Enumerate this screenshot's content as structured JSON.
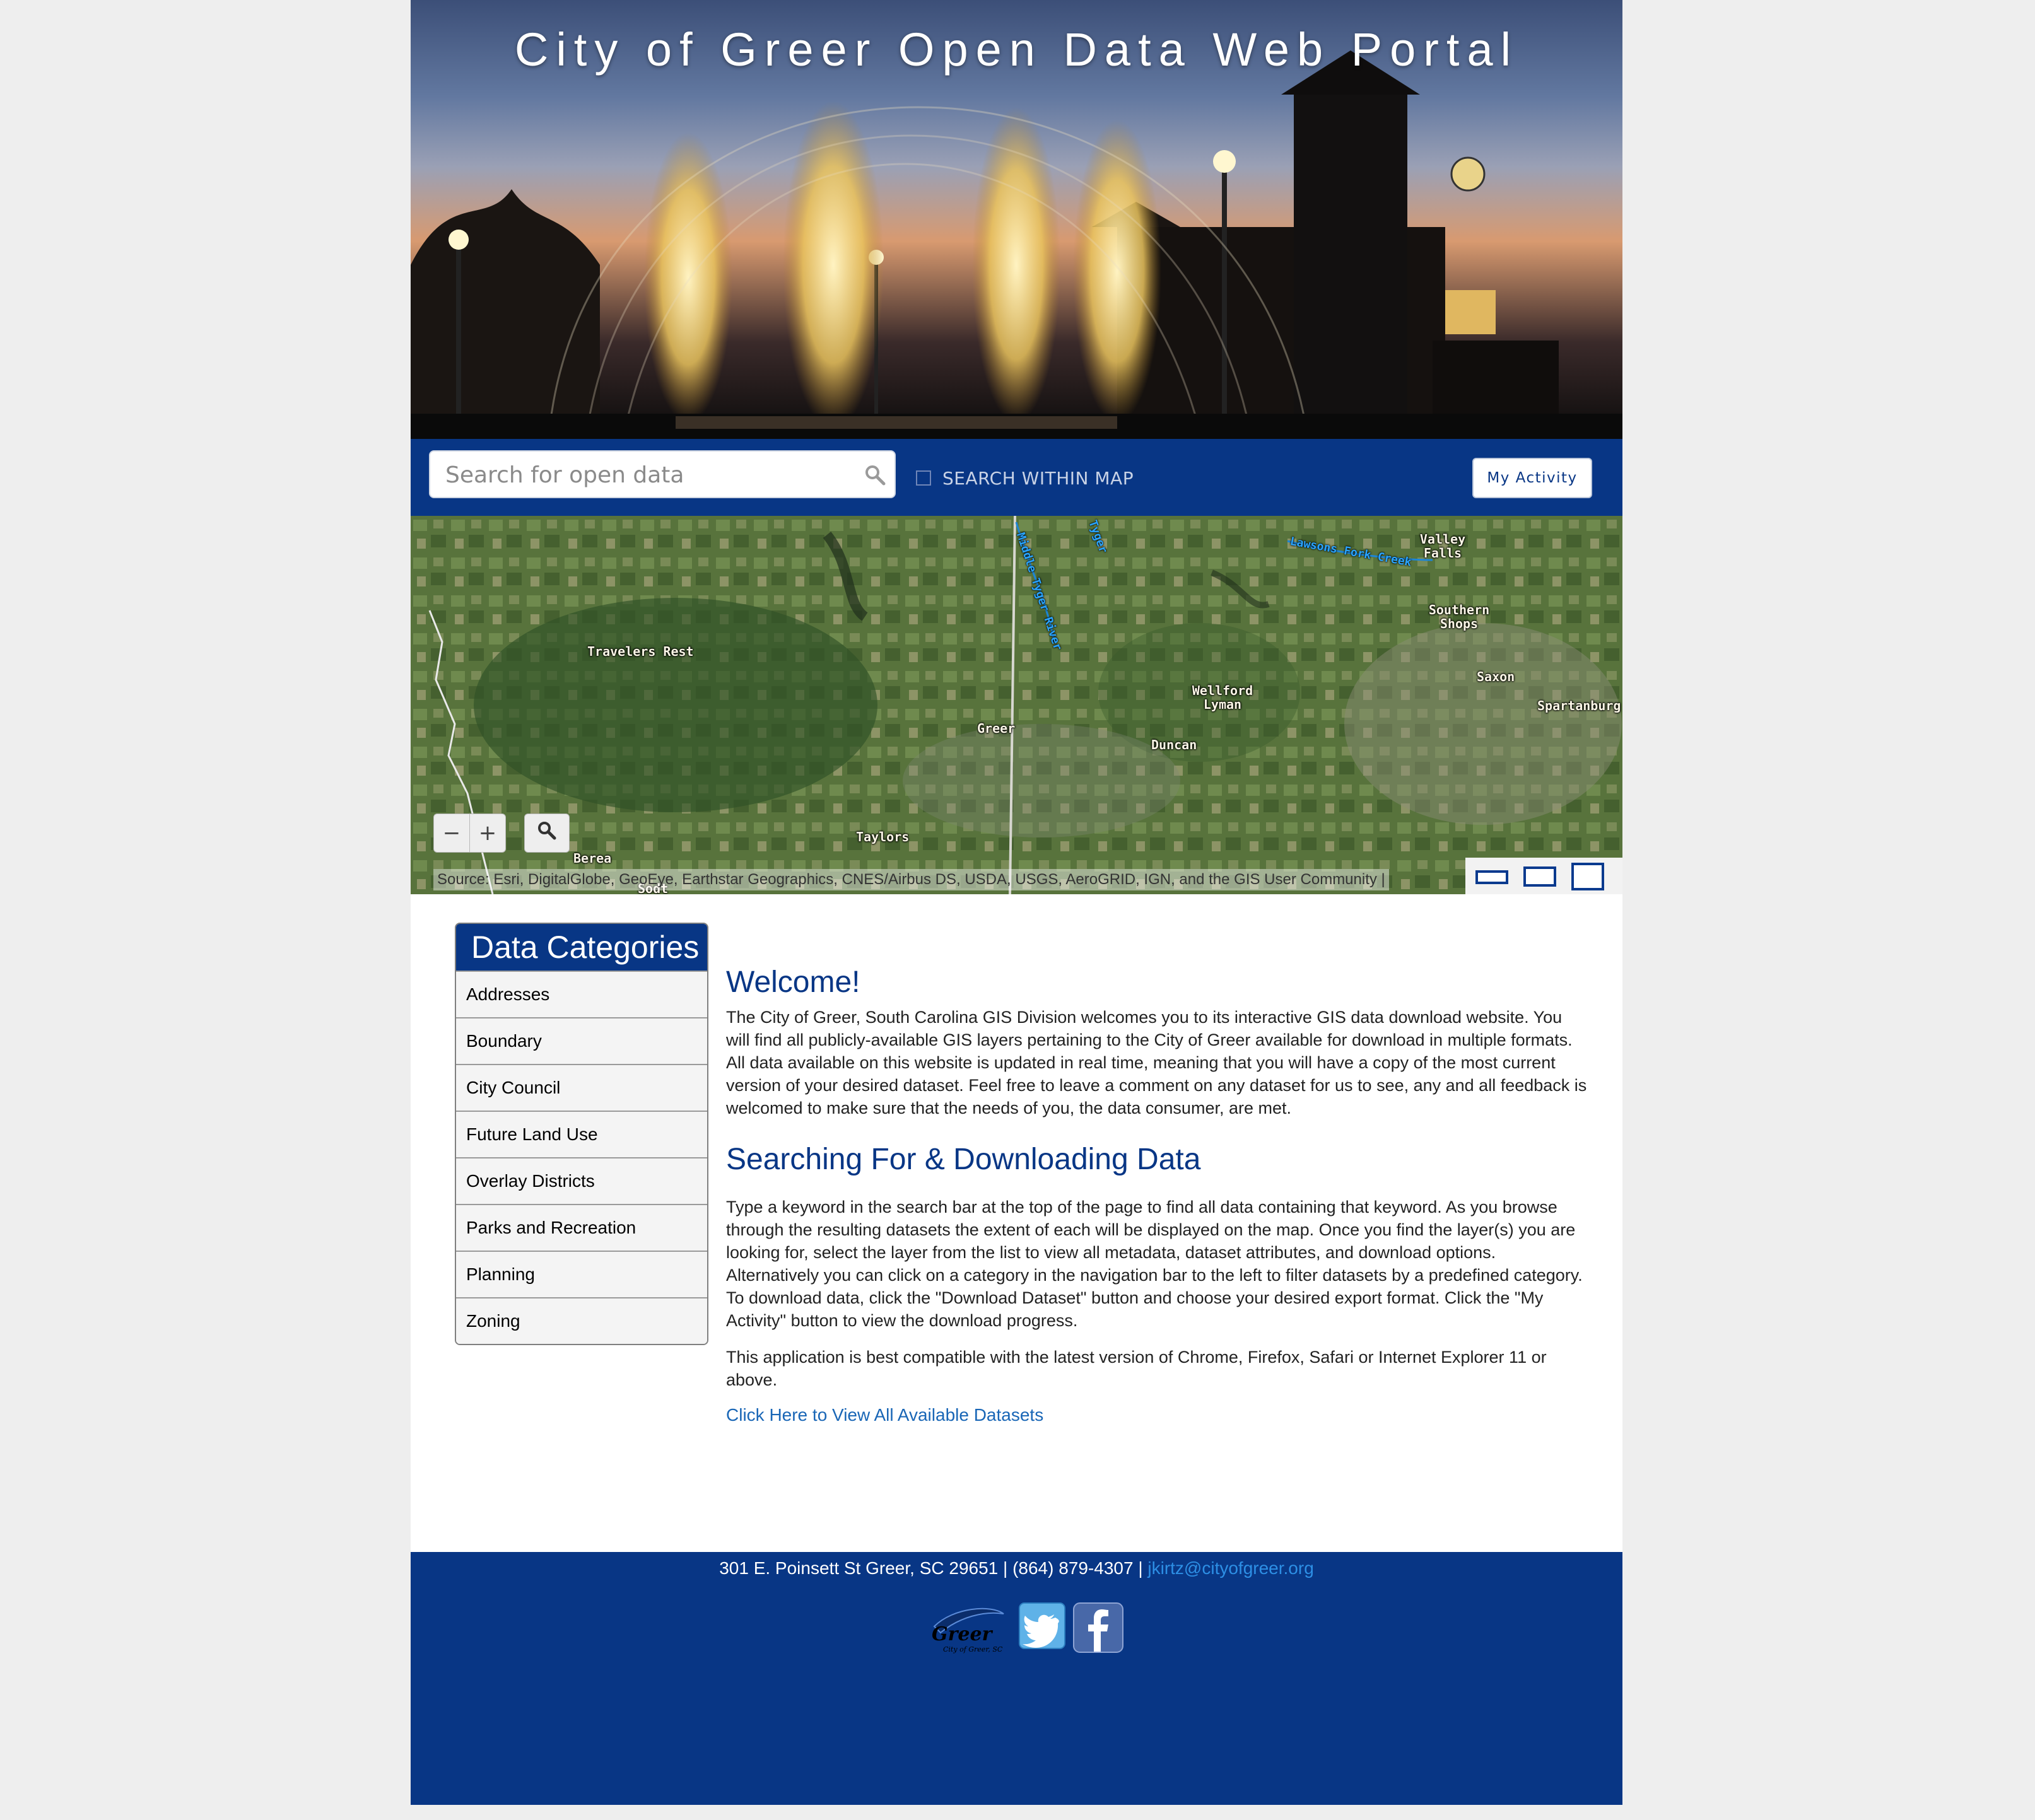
{
  "banner": {
    "title": "City of Greer Open Data Web Portal"
  },
  "search": {
    "placeholder": "Search for open data",
    "within_map_label": "SEARCH WITHIN MAP",
    "activity_button": "My Activity"
  },
  "map": {
    "labels": {
      "travelers_rest": "Travelers Rest",
      "greer": "Greer",
      "wellford_lyman": "Wellford Lyman",
      "duncan": "Duncan",
      "valley_falls": "Valley Falls",
      "southern_shops": "Southern Shops",
      "saxon": "Saxon",
      "spartanburg": "Spartanburg",
      "taylors": "Taylors",
      "berea": "Berea",
      "sodt": "Sodt"
    },
    "rivers": {
      "middle_tyger": "Middle Tyger River",
      "lawsons_fork": "Lawsons Fork Creek",
      "tyger": "Tyger"
    },
    "zoom_out": "−",
    "zoom_in": "+",
    "attribution": "Source: Esri, DigitalGlobe, GeoEye, Earthstar Geographics, CNES/Airbus DS, USDA, USGS, AeroGRID, IGN, and the GIS User Community |"
  },
  "sidebar": {
    "title": "Data Categories",
    "items": [
      "Addresses",
      "Boundary",
      "City Council",
      "Future Land Use",
      "Overlay Districts",
      "Parks and Recreation",
      "Planning",
      "Zoning"
    ]
  },
  "main": {
    "welcome_heading": "Welcome!",
    "welcome_text": "The City of Greer, South Carolina GIS Division welcomes you to its interactive GIS data download website. You will find all publicly-available GIS layers pertaining to the City of Greer available for download in multiple formats. All data available on this website is updated in real time, meaning that you will have a copy of the most current version of your desired dataset. Feel free to leave a comment on any dataset for us to see, any and all feedback is welcomed to make sure that the needs of you, the data consumer, are met.",
    "search_heading": "Searching For & Downloading Data",
    "search_text": "Type a keyword in the search bar at the top of the page to find all data containing that keyword. As you browse through the resulting datasets the extent of each will be displayed on the map. Once you find the layer(s) you are looking for, select the layer from the list to view all metadata, dataset attributes, and download options. Alternatively you can click on a category in the navigation bar to the left to filter datasets by a predefined category. To download data, click the \"Download Dataset\" button and choose your desired export format. Click the \"My Activity\" button to view the download progress.",
    "compat_text": "This application is best compatible with the latest version of Chrome, Firefox, Safari or Internet Explorer 11 or above.",
    "view_all_link": "Click Here to View All Available Datasets"
  },
  "footer": {
    "address": "301 E. Poinsett St Greer, SC 29651 | (864) 879-4307 | ",
    "email": "jkirtz@cityofgreer.org",
    "logo_text": "Greer",
    "logo_subtext": "City of Greer, SC"
  },
  "colors": {
    "brand_blue": "#083685",
    "link_blue": "#1966b6",
    "email_blue": "#2d8fe5"
  }
}
